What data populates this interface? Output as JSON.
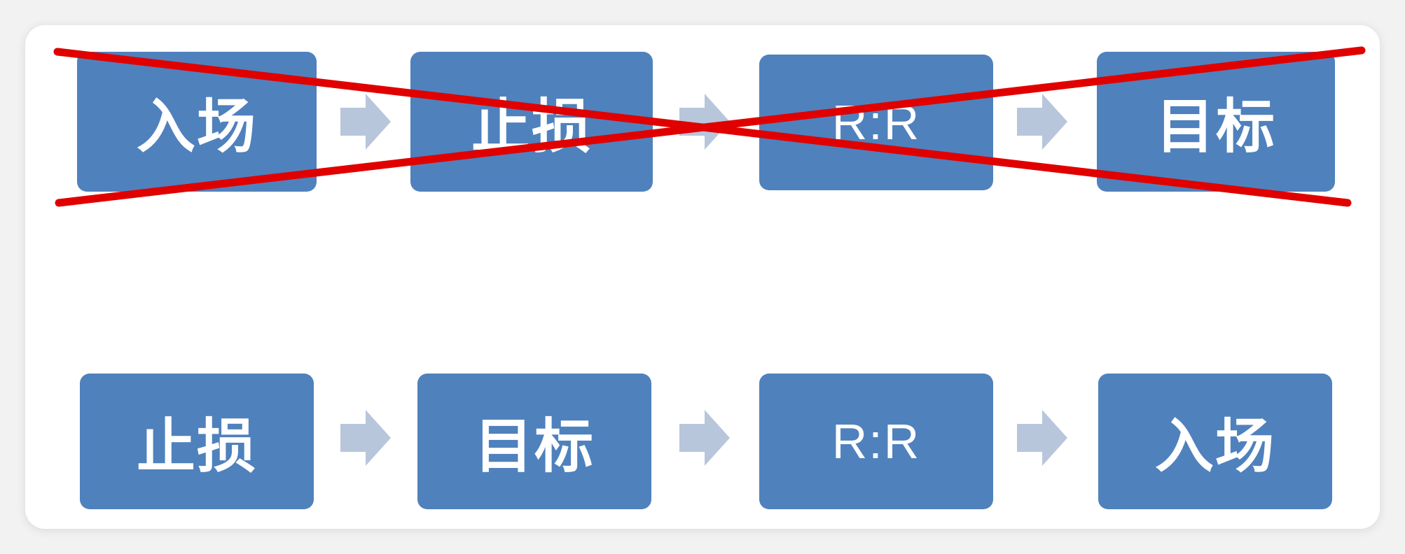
{
  "diagram": {
    "top_flow": {
      "steps": [
        "入场",
        "止损",
        "R:R",
        "目标"
      ],
      "crossed_out": true
    },
    "bottom_flow": {
      "steps": [
        "止损",
        "目标",
        "R:R",
        "入场"
      ]
    },
    "colors": {
      "box_fill": "#4f81bd",
      "box_text": "#ffffff",
      "arrow_fill": "#b8c6dc",
      "cross_line": "#e00000",
      "background": "#ffffff"
    },
    "icons": {
      "connector": "chevron-arrow-right-icon",
      "strike": "red-x-cross"
    }
  }
}
